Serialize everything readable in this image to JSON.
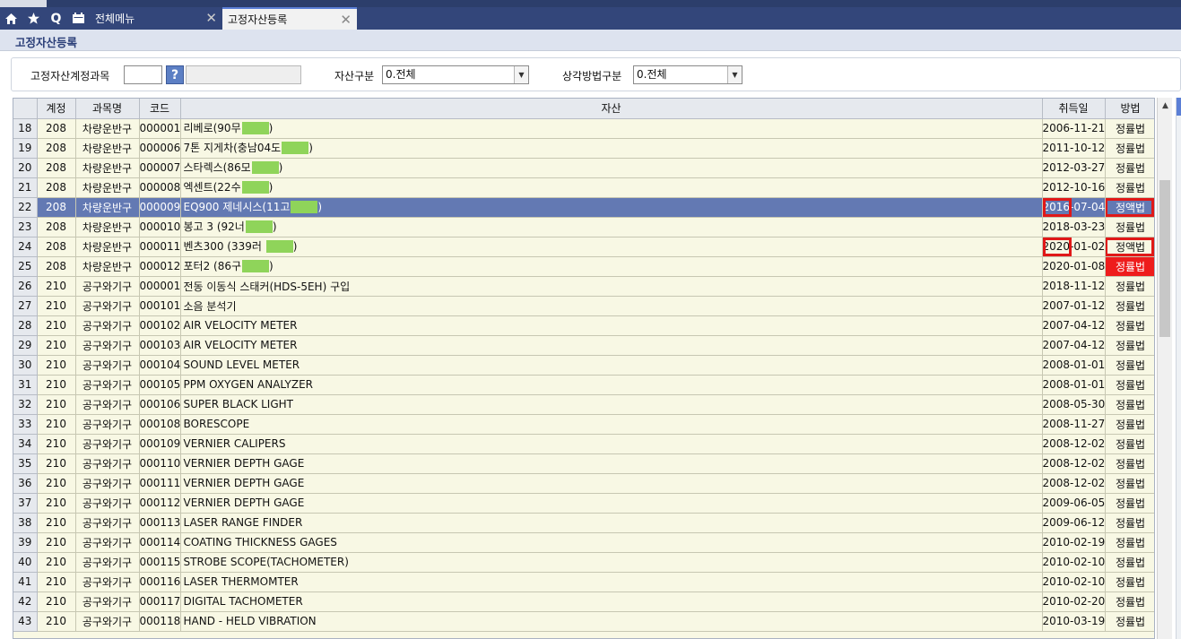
{
  "tabs": {
    "menu_label": "전체메뉴",
    "active_label": "고정자산등록",
    "close_glyph": "✕",
    "icons": [
      "home-icon",
      "star-icon",
      "search-icon",
      "calendar-icon"
    ],
    "search_glyph": "Q"
  },
  "page": {
    "title": "고정자산등록"
  },
  "filter": {
    "account_label": "고정자산계정과목",
    "account_value": "",
    "lookup_glyph": "?",
    "asset_type_label": "자산구분",
    "asset_type_value": "0.전체",
    "depreciation_label": "상각방법구분",
    "depreciation_value": "0.전체"
  },
  "colors": {
    "selected_row": "#6379b3",
    "highlight": "#e01818",
    "tab_bar": "#33467a"
  },
  "table": {
    "columns": [
      "계정",
      "과목명",
      "코드",
      "자산",
      "취득일",
      "방법"
    ],
    "rows": [
      {
        "n": "18",
        "acct": "208",
        "subject": "차량운반구",
        "code": "000001",
        "asset": "리베로(90무",
        "mask": true,
        "asset_suffix": ")",
        "date": "2006-11-21",
        "method": "정률법"
      },
      {
        "n": "19",
        "acct": "208",
        "subject": "차량운반구",
        "code": "000006",
        "asset": "7톤 지게차(충남04도",
        "mask": true,
        "asset_suffix": ")",
        "date": "2011-10-12",
        "method": "정률법"
      },
      {
        "n": "20",
        "acct": "208",
        "subject": "차량운반구",
        "code": "000007",
        "asset": "스타렉스(86모",
        "mask": true,
        "asset_suffix": ")",
        "date": "2012-03-27",
        "method": "정률법"
      },
      {
        "n": "21",
        "acct": "208",
        "subject": "차량운반구",
        "code": "000008",
        "asset": "엑센트(22수",
        "mask": true,
        "asset_suffix": ")",
        "date": "2012-10-16",
        "method": "정률법"
      },
      {
        "n": "22",
        "acct": "208",
        "subject": "차량운반구",
        "code": "000009",
        "asset": "EQ900 제네시스(11고",
        "mask": true,
        "asset_suffix": ")",
        "date": "2016-07-04",
        "method": "정액법",
        "selected": true,
        "hl_date": true,
        "hl_method": true
      },
      {
        "n": "23",
        "acct": "208",
        "subject": "차량운반구",
        "code": "000010",
        "asset": "봉고 3 (92너",
        "mask": true,
        "asset_suffix": ")",
        "date": "2018-03-23",
        "method": "정률법"
      },
      {
        "n": "24",
        "acct": "208",
        "subject": "차량운반구",
        "code": "000011",
        "asset": "벤츠300 (339러 ",
        "mask": true,
        "asset_suffix": ")",
        "date": "2020-01-02",
        "method": "정액법",
        "hl_date": true,
        "hl_method": true
      },
      {
        "n": "25",
        "acct": "208",
        "subject": "차량운반구",
        "code": "000012",
        "asset": "포터2 (86구",
        "mask": true,
        "asset_suffix": ")",
        "date": "2020-01-08",
        "method": "정률법",
        "red_method": true
      },
      {
        "n": "26",
        "acct": "210",
        "subject": "공구와기구",
        "code": "000001",
        "asset": "전동 이동식 스태커(HDS-5EH) 구입",
        "date": "2018-11-12",
        "method": "정률법"
      },
      {
        "n": "27",
        "acct": "210",
        "subject": "공구와기구",
        "code": "000101",
        "asset": "소음 분석기",
        "date": "2007-01-12",
        "method": "정률법"
      },
      {
        "n": "28",
        "acct": "210",
        "subject": "공구와기구",
        "code": "000102",
        "asset": "AIR VELOCITY METER",
        "date": "2007-04-12",
        "method": "정률법"
      },
      {
        "n": "29",
        "acct": "210",
        "subject": "공구와기구",
        "code": "000103",
        "asset": "AIR VELOCITY METER",
        "date": "2007-04-12",
        "method": "정률법"
      },
      {
        "n": "30",
        "acct": "210",
        "subject": "공구와기구",
        "code": "000104",
        "asset": "SOUND LEVEL METER",
        "date": "2008-01-01",
        "method": "정률법"
      },
      {
        "n": "31",
        "acct": "210",
        "subject": "공구와기구",
        "code": "000105",
        "asset": "PPM OXYGEN ANALYZER",
        "date": "2008-01-01",
        "method": "정률법"
      },
      {
        "n": "32",
        "acct": "210",
        "subject": "공구와기구",
        "code": "000106",
        "asset": "SUPER BLACK LIGHT",
        "date": "2008-05-30",
        "method": "정률법"
      },
      {
        "n": "33",
        "acct": "210",
        "subject": "공구와기구",
        "code": "000108",
        "asset": "BORESCOPE",
        "date": "2008-11-27",
        "method": "정률법"
      },
      {
        "n": "34",
        "acct": "210",
        "subject": "공구와기구",
        "code": "000109",
        "asset": "VERNIER CALIPERS",
        "date": "2008-12-02",
        "method": "정률법"
      },
      {
        "n": "35",
        "acct": "210",
        "subject": "공구와기구",
        "code": "000110",
        "asset": "VERNIER DEPTH GAGE",
        "date": "2008-12-02",
        "method": "정률법"
      },
      {
        "n": "36",
        "acct": "210",
        "subject": "공구와기구",
        "code": "000111",
        "asset": "VERNIER DEPTH GAGE",
        "date": "2008-12-02",
        "method": "정률법"
      },
      {
        "n": "37",
        "acct": "210",
        "subject": "공구와기구",
        "code": "000112",
        "asset": "VERNIER DEPTH GAGE",
        "date": "2009-06-05",
        "method": "정률법"
      },
      {
        "n": "38",
        "acct": "210",
        "subject": "공구와기구",
        "code": "000113",
        "asset": "LASER RANGE FINDER",
        "date": "2009-06-12",
        "method": "정률법"
      },
      {
        "n": "39",
        "acct": "210",
        "subject": "공구와기구",
        "code": "000114",
        "asset": "COATING THICKNESS GAGES",
        "date": "2010-02-19",
        "method": "정률법"
      },
      {
        "n": "40",
        "acct": "210",
        "subject": "공구와기구",
        "code": "000115",
        "asset": "STROBE SCOPE(TACHOMETER)",
        "date": "2010-02-10",
        "method": "정률법"
      },
      {
        "n": "41",
        "acct": "210",
        "subject": "공구와기구",
        "code": "000116",
        "asset": "LASER THERMOMTER",
        "date": "2010-02-10",
        "method": "정률법"
      },
      {
        "n": "42",
        "acct": "210",
        "subject": "공구와기구",
        "code": "000117",
        "asset": "DIGITAL TACHOMETER",
        "date": "2010-02-20",
        "method": "정률법"
      },
      {
        "n": "43",
        "acct": "210",
        "subject": "공구와기구",
        "code": "000118",
        "asset": "HAND - HELD VIBRATION",
        "date": "2010-03-19",
        "method": "정률법"
      }
    ]
  }
}
